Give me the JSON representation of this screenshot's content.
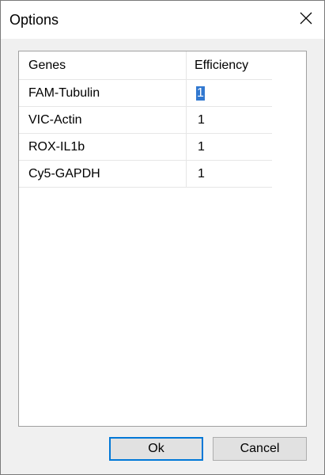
{
  "window": {
    "title": "Options",
    "close_icon": "close-icon"
  },
  "table": {
    "columns": [
      "Genes",
      "Efficiency"
    ],
    "rows": [
      {
        "gene": "FAM-Tubulin",
        "efficiency": "1",
        "selected": true
      },
      {
        "gene": "VIC-Actin",
        "efficiency": "1"
      },
      {
        "gene": "ROX-IL1b",
        "efficiency": "1"
      },
      {
        "gene": "Cy5-GAPDH",
        "efficiency": "1"
      }
    ]
  },
  "buttons": {
    "ok_label": "Ok",
    "cancel_label": "Cancel"
  },
  "colors": {
    "selection": "#3178d0",
    "focus_border": "#0078d7"
  }
}
